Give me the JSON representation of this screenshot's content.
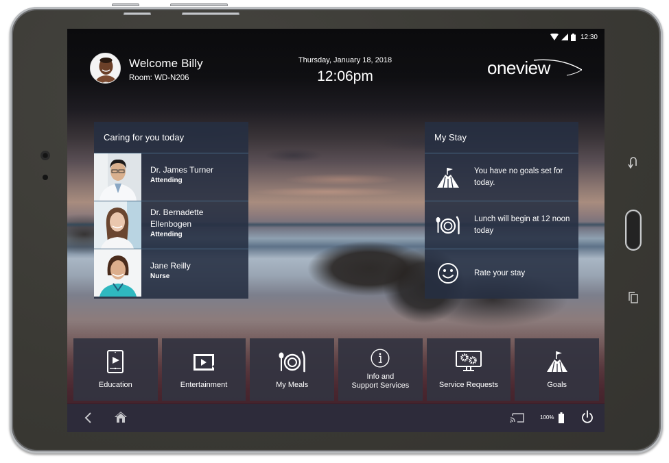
{
  "status_bar": {
    "time": "12:30",
    "icons": [
      "wifi-icon",
      "cell-signal-icon",
      "battery-icon"
    ]
  },
  "header": {
    "welcome": "Welcome Billy",
    "room": "Room: WD-N206",
    "date": "Thursday, January 18, 2018",
    "time": "12:06pm",
    "logo": "oneview"
  },
  "care_team": {
    "title": "Caring for you today",
    "members": [
      {
        "name": "Dr. James Turner",
        "role": "Attending"
      },
      {
        "name": "Dr. Bernadette Ellenbogen",
        "role": "Attending"
      },
      {
        "name": "Jane Reilly",
        "role": "Nurse"
      }
    ]
  },
  "my_stay": {
    "title": "My Stay",
    "items": [
      {
        "icon": "mountain-flag-icon",
        "text": "You have no goals set for today."
      },
      {
        "icon": "meal-icon",
        "text": "Lunch will begin at 12 noon today"
      },
      {
        "icon": "smiley-icon",
        "text": "Rate your stay"
      }
    ]
  },
  "tiles": [
    {
      "icon": "tablet-play-icon",
      "label": "Education"
    },
    {
      "icon": "video-screen-icon",
      "label": "Entertainment"
    },
    {
      "icon": "meal-icon",
      "label": "My Meals"
    },
    {
      "icon": "info-icon",
      "label_line1": "Info and",
      "label_line2": "Support Services"
    },
    {
      "icon": "gears-monitor-icon",
      "label": "Service Requests"
    },
    {
      "icon": "mountain-flag-icon",
      "label": "Goals"
    }
  ],
  "navbar": {
    "battery_level": "100%",
    "icons": [
      "back-icon",
      "home-icon",
      "cast-icon",
      "battery-icon",
      "power-icon"
    ]
  },
  "colors": {
    "panel_bg": "#262f42",
    "tile_bg": "#343440",
    "navbar_bg": "#2d2b3a",
    "divider": "#4a6a86",
    "text": "#ffffff"
  }
}
